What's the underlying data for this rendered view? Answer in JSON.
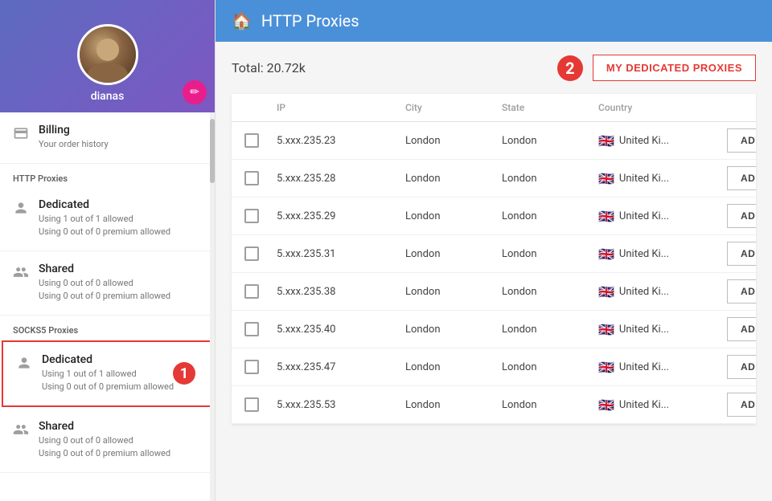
{
  "sidebar": {
    "username": "dianas",
    "edit_icon": "✏",
    "billing": {
      "title": "Billing",
      "subtitle": "Your order history"
    },
    "http_proxies_label": "HTTP Proxies",
    "http_dedicated": {
      "title": "Dedicated",
      "line1": "Using 1 out of 1 allowed",
      "line2": "Using 0 out of 0 premium allowed"
    },
    "http_shared": {
      "title": "Shared",
      "line1": "Using 0 out of 0 allowed",
      "line2": "Using 0 out of 0 premium allowed"
    },
    "socks5_proxies_label": "SOCKS5 Proxies",
    "socks5_dedicated": {
      "title": "Dedicated",
      "line1": "Using 1 out of 1 allowed",
      "line2": "Using 0 out of 0 premium allowed"
    },
    "socks5_shared": {
      "title": "Shared",
      "line1": "Using 0 out of 0 allowed",
      "line2": "Using 0 out of 0 premium allowed"
    }
  },
  "topbar": {
    "title": "HTTP Proxies",
    "home_icon": "🏠"
  },
  "content": {
    "total": "Total: 20.72k",
    "my_dedicated_btn": "MY DEDICATED PROXIES",
    "badge": "2",
    "columns": [
      "",
      "IP",
      "City",
      "State",
      "Country",
      ""
    ],
    "rows": [
      {
        "ip": "5.xxx.235.23",
        "city": "London",
        "state": "London",
        "country": "United Ki...",
        "flag": "🇬🇧"
      },
      {
        "ip": "5.xxx.235.28",
        "city": "London",
        "state": "London",
        "country": "United Ki...",
        "flag": "🇬🇧"
      },
      {
        "ip": "5.xxx.235.29",
        "city": "London",
        "state": "London",
        "country": "United Ki...",
        "flag": "🇬🇧"
      },
      {
        "ip": "5.xxx.235.31",
        "city": "London",
        "state": "London",
        "country": "United Ki...",
        "flag": "🇬🇧"
      },
      {
        "ip": "5.xxx.235.38",
        "city": "London",
        "state": "London",
        "country": "United Ki...",
        "flag": "🇬🇧"
      },
      {
        "ip": "5.xxx.235.40",
        "city": "London",
        "state": "London",
        "country": "United Ki...",
        "flag": "🇬🇧"
      },
      {
        "ip": "5.xxx.235.47",
        "city": "London",
        "state": "London",
        "country": "United Ki...",
        "flag": "🇬🇧"
      },
      {
        "ip": "5.xxx.235.53",
        "city": "London",
        "state": "London",
        "country": "United Ki...",
        "flag": "🇬🇧"
      }
    ],
    "add_to_cart_label": "ADD TO CART"
  }
}
